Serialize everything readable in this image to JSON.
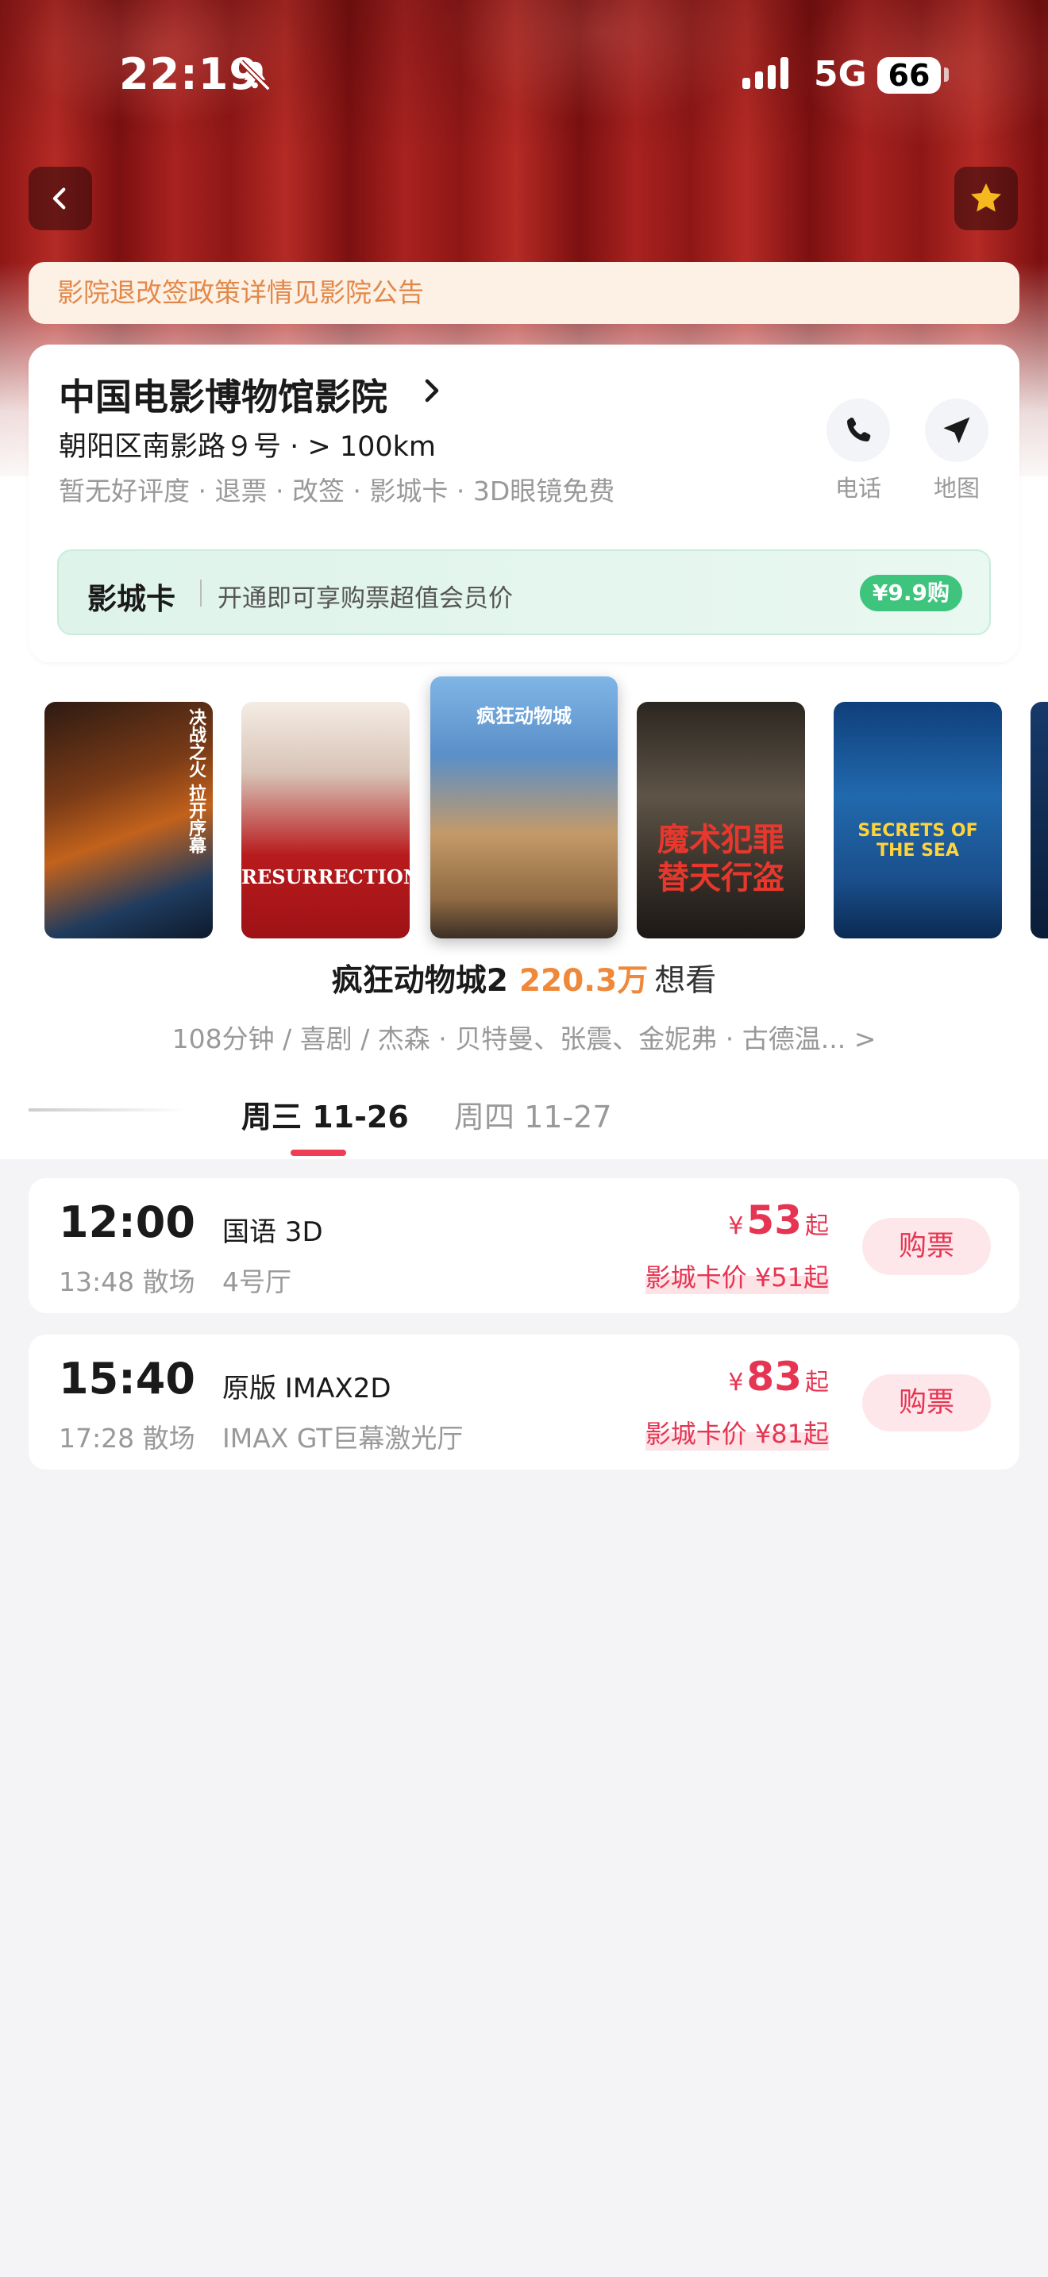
{
  "status_bar": {
    "time": "22:19",
    "network": "5G",
    "battery": "66"
  },
  "notice": "影院退改签政策详情见影院公告",
  "cinema": {
    "name": "中国电影博物馆影院",
    "address": "朝阳区南影路９号 · > 100km",
    "tags": "暂无好评度 · 退票 · 改签 · 影城卡 · 3D眼镜免费",
    "actions": {
      "phone": "电话",
      "map": "地图"
    },
    "vip_card": {
      "title": "影城卡",
      "desc": "开通即可享购票超值会员价",
      "price": "¥9.9购"
    }
  },
  "posters": [
    {
      "name": "demon-slayer-poster",
      "text": "决战之火 拉开序幕"
    },
    {
      "name": "resurrection-poster",
      "text": "RESURRECTION"
    },
    {
      "name": "zootopia2-poster",
      "text": "疯狂动物城"
    },
    {
      "name": "now-you-see-me3-poster",
      "text": "魔术犯罪 替天行盗"
    },
    {
      "name": "secrets-of-the-sea-poster",
      "text": "SECRETS OF THE SEA"
    }
  ],
  "movie": {
    "title": "疯狂动物城2",
    "want_count": "220.3万",
    "want_label": "想看",
    "meta": "108分钟 / 喜剧 / 杰森 · 贝特曼、张震、金妮弗 · 古德温... >"
  },
  "dates": [
    {
      "label": "周三 11-26",
      "active": true
    },
    {
      "label": "周四  11-27",
      "active": false
    }
  ],
  "showtimes": [
    {
      "start": "12:00",
      "end": "13:48 散场",
      "lang": "国语 3D",
      "hall": "4号厅",
      "currency": "¥",
      "price": "53",
      "price_suffix": "起",
      "card_price": "影城卡价 ¥51起",
      "buy": "购票"
    },
    {
      "start": "15:40",
      "end": "17:28 散场",
      "lang": "原版 IMAX2D",
      "hall": "IMAX GT巨幕激光厅",
      "currency": "¥",
      "price": "83",
      "price_suffix": "起",
      "card_price": "影城卡价 ¥81起",
      "buy": "购票"
    }
  ],
  "colors": {
    "accent_red": "#e63552",
    "want_orange": "#f0883a",
    "vip_green": "#3ec47d",
    "notice_orange": "#e2894a"
  }
}
